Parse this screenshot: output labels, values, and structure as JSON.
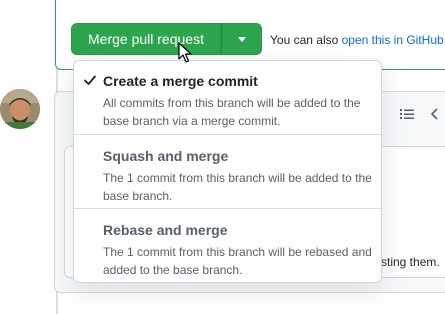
{
  "merge": {
    "button_label": "Merge pull request",
    "also_text": "You can also",
    "also_link": "open this in GitHub"
  },
  "dropdown": {
    "items": [
      {
        "title": "Create a merge commit",
        "description": "All commits from this branch will be added to the base branch via a merge commit.",
        "selected": true
      },
      {
        "title": "Squash and merge",
        "description": "The 1 commit from this branch will be added to the base branch.",
        "selected": false
      },
      {
        "title": "Rebase and merge",
        "description": "The 1 commit from this branch will be rebased and added to the base branch.",
        "selected": false
      }
    ]
  },
  "comment": {
    "partial_text": "sting them."
  },
  "icons": {
    "merge_caret": "caret-down-icon",
    "check": "check-icon",
    "toolbar": [
      "list-icon",
      "code-icon"
    ],
    "cursor": "pointer-cursor-icon"
  },
  "colors": {
    "merge_green": "#2da44e",
    "link_blue": "#0969da",
    "border": "#d0d7de",
    "muted_text": "#57606a"
  }
}
